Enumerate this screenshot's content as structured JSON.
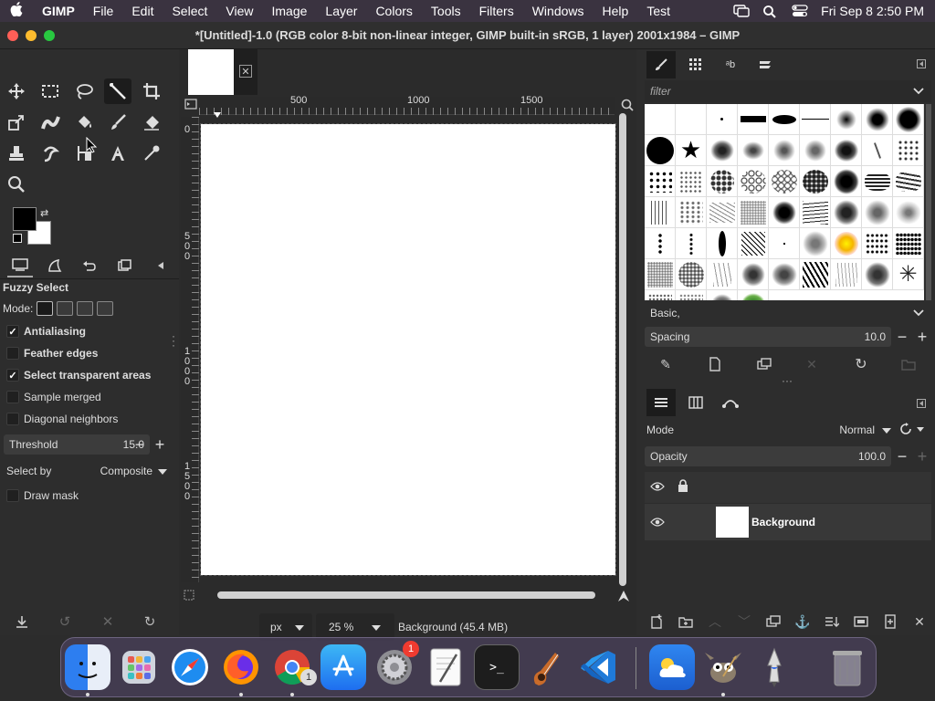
{
  "menubar": {
    "app_name": "GIMP",
    "items": [
      "File",
      "Edit",
      "Select",
      "View",
      "Image",
      "Layer",
      "Colors",
      "Tools",
      "Filters",
      "Windows",
      "Help",
      "Test"
    ],
    "clock": "Fri Sep 8  2:50 PM"
  },
  "window": {
    "title": "*[Untitled]-1.0 (RGB color 8-bit non-linear integer, GIMP built-in sRGB, 1 layer) 2001x1984 – GIMP"
  },
  "toolbox": {
    "tools": [
      "move-tool-icon",
      "rect-select-icon",
      "lasso-icon",
      "fuzzy-select-icon",
      "crop-icon",
      "transform-icon",
      "warp-icon",
      "bucket-fill-icon",
      "paintbrush-icon",
      "eraser-icon",
      "clone-icon",
      "smudge-icon",
      "paths-icon",
      "text-icon",
      "color-picker-icon",
      "zoom-icon"
    ],
    "active_tool": "fuzzy-select-icon"
  },
  "tool_options": {
    "title": "Fuzzy Select",
    "mode_label": "Mode:",
    "antialiasing": {
      "label": "Antialiasing",
      "checked": true
    },
    "feather_edges": {
      "label": "Feather edges",
      "checked": false
    },
    "select_transparent": {
      "label": "Select transparent areas",
      "checked": true
    },
    "sample_merged": {
      "label": "Sample merged",
      "checked": false
    },
    "diagonal_neighbors": {
      "label": "Diagonal neighbors",
      "checked": false
    },
    "threshold": {
      "label": "Threshold",
      "value": "15.0"
    },
    "select_by": {
      "label": "Select by",
      "value": "Composite"
    },
    "draw_mask": {
      "label": "Draw mask",
      "checked": false
    }
  },
  "canvas": {
    "ruler_h": [
      "500",
      "1000",
      "1500"
    ],
    "ruler_v_top": "0",
    "ruler_v_labels": [
      "500",
      "1000",
      "1500"
    ],
    "unit": "px",
    "zoom": "25 %",
    "status": "Background (45.4 MB)"
  },
  "brushes": {
    "filter_placeholder": "filter",
    "preset": "Basic,",
    "spacing": {
      "label": "Spacing",
      "value": "10.0"
    }
  },
  "layers": {
    "mode": {
      "label": "Mode",
      "value": "Normal"
    },
    "opacity": {
      "label": "Opacity",
      "value": "100.0"
    },
    "items": [
      {
        "name": "Background"
      }
    ]
  },
  "dock": {
    "apps": [
      "finder",
      "launchpad",
      "safari",
      "firefox",
      "chrome",
      "app-store",
      "system-settings",
      "textedit",
      "terminal",
      "garageband",
      "vscode",
      "weather",
      "gimp",
      "gimp-alt",
      "trash"
    ],
    "badges": {
      "chrome": "1",
      "system_settings": "1"
    }
  },
  "colors": {
    "accent": "#3a3340",
    "panel": "#2d2d2d",
    "foreground": "#000000",
    "background": "#ffffff"
  }
}
